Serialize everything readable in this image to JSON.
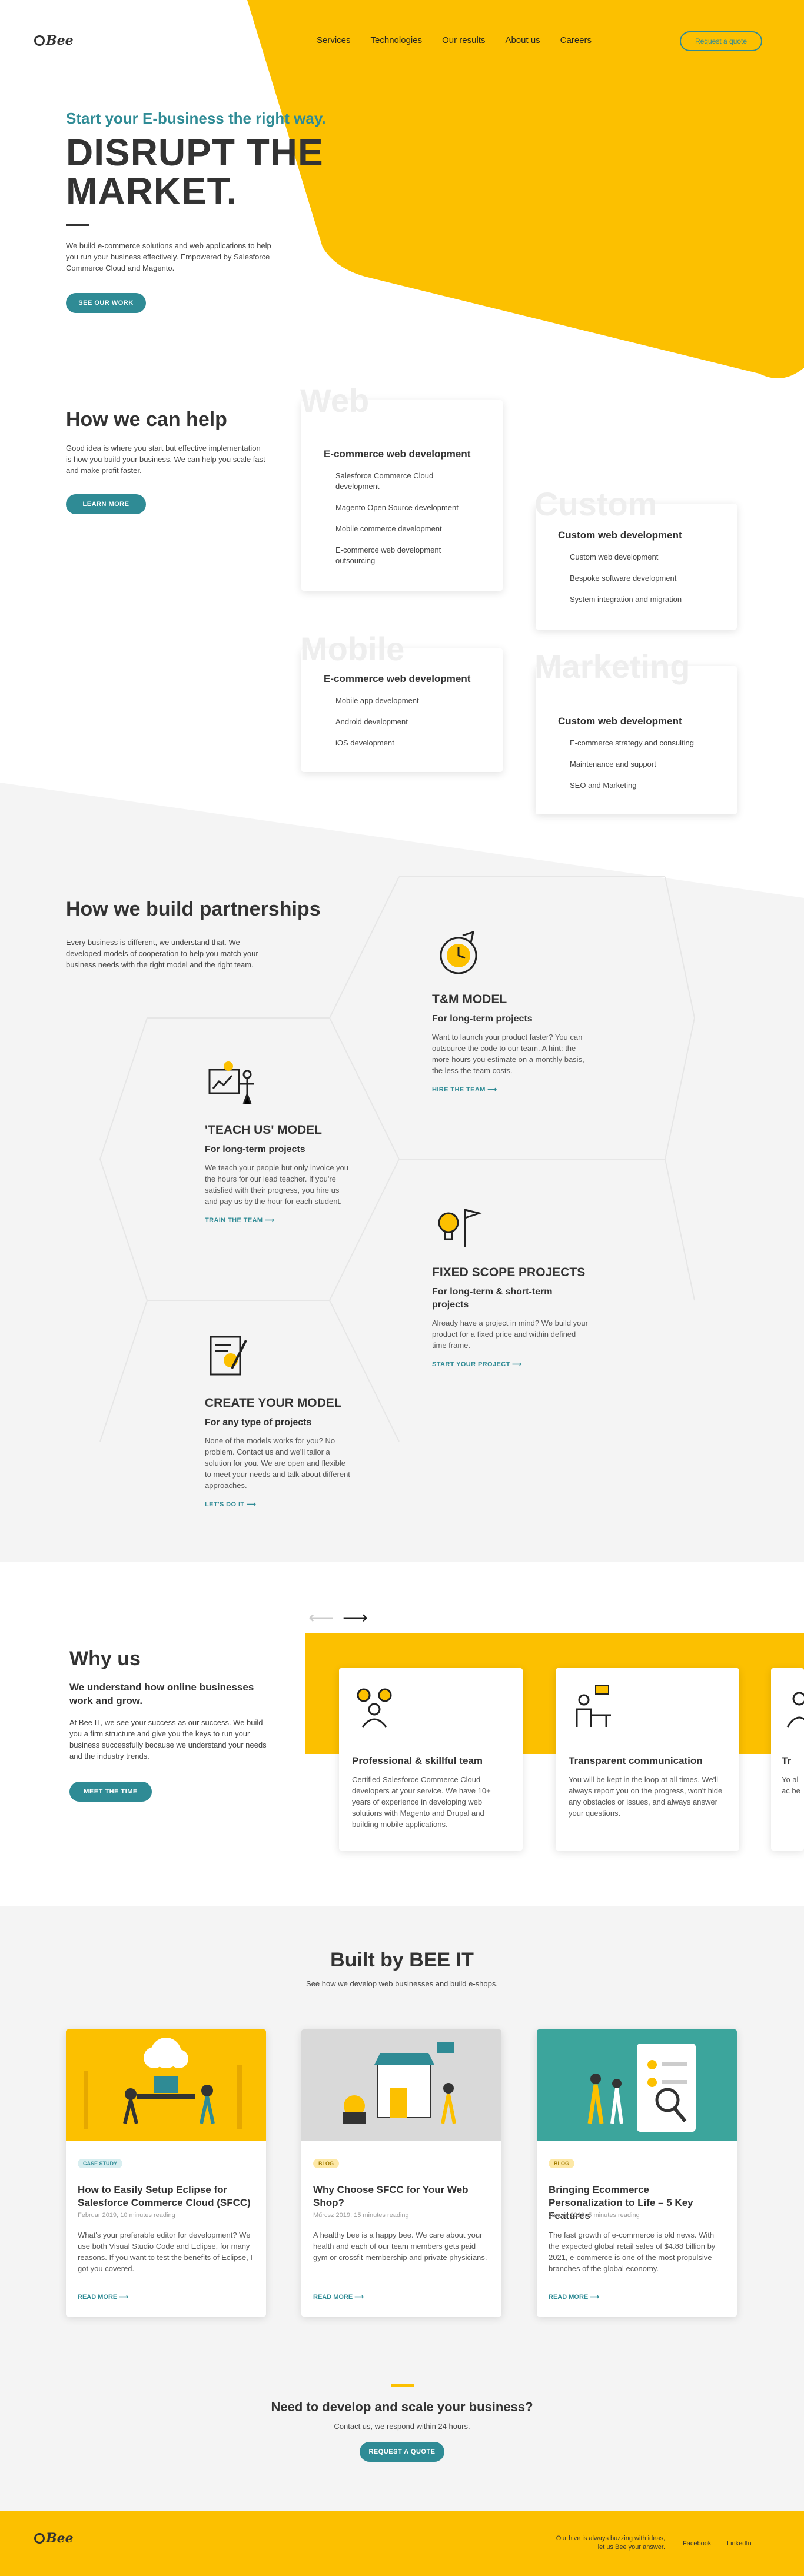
{
  "colors": {
    "accent": "#fcc000",
    "brand": "#2f8b95",
    "text": "#333333"
  },
  "nav": {
    "logo": "Bee",
    "links": [
      "Services",
      "Technologies",
      "Our results",
      "About us",
      "Careers"
    ],
    "cta": "Request a quote"
  },
  "hero": {
    "tag": "Start your E-business the right way.",
    "title_line1": "DISRUPT THE",
    "title_line2": "MARKET.",
    "text": "We build e-commerce solutions and web applications to help you run your business effectively. Empowered by Salesforce Commerce Cloud and Magento.",
    "button": "SEE OUR WORK"
  },
  "help": {
    "title": "How we can help",
    "text": "Good idea is where you start but effective implementation is how you build your business. We can help you scale fast and make profit faster.",
    "button": "LEARN MORE",
    "cards": [
      {
        "ghost": "Web",
        "title": "E-commerce web development",
        "items": [
          "Salesforce Commerce Cloud development",
          "Magento Open Source development",
          "Mobile commerce development",
          "E-commerce web development outsourcing"
        ]
      },
      {
        "ghost": "Custom",
        "title": "Custom web development",
        "items": [
          "Custom web development",
          "Bespoke software development",
          "System integration and migration"
        ]
      },
      {
        "ghost": "Mobile",
        "title": "E-commerce web development",
        "items": [
          "Mobile app development",
          "Android development",
          "iOS development"
        ]
      },
      {
        "ghost": "Marketing",
        "title": "Custom web development",
        "items": [
          "E-commerce strategy and consulting",
          "Maintenance and support",
          "SEO and Marketing"
        ]
      }
    ]
  },
  "partners": {
    "title": "How we build partnerships",
    "text": "Every business is different, we understand that. We developed models of cooperation to help you match your business needs with the right model and the right team.",
    "models": [
      {
        "icon": "clock-arrow-icon",
        "title": "T&M MODEL",
        "subtitle": "For long-term projects",
        "text": "Want to launch your product faster? You can outsource the code to our team. A hint: the more hours you estimate on a monthly basis, the less the team costs.",
        "link": "HIRE THE TEAM"
      },
      {
        "icon": "teacher-board-icon",
        "title": "'TEACH US' MODEL",
        "subtitle": "For long-term projects",
        "text": "We teach your people but only invoice you the hours for our lead teacher. If you're satisfied with their progress, you hire us and pay us by the hour for each student.",
        "link": "TRAIN THE TEAM"
      },
      {
        "icon": "lightbulb-flag-icon",
        "title": "FIXED SCOPE PROJECTS",
        "subtitle": "For long-term & short-term projects",
        "text": "Already have a project in mind? We build your product for a fixed price and within defined time frame.",
        "link": "START YOUR PROJECT"
      },
      {
        "icon": "document-pen-icon",
        "title": "CREATE YOUR MODEL",
        "subtitle": "For any type of projects",
        "text": "None of the models works for you? No problem. Contact us and we'll tailor a solution for you. We are open and flexible to meet your needs and talk about different approaches.",
        "link": "LET'S DO IT"
      }
    ]
  },
  "why": {
    "title": "Why us",
    "subtitle": "We understand how online businesses work and grow.",
    "text": "At Bee IT, we see your success as our success. We build you a firm structure and give you the keys to run your business successfully because we understand your needs and the industry trends.",
    "button": "MEET THE TIME",
    "cards": [
      {
        "icon": "team-gears-icon",
        "title": "Professional & skillful team",
        "text": "Certified Salesforce Commerce Cloud developers at your service. We have 10+ years of experience in developing web solutions with Magento and Drupal and building mobile applications."
      },
      {
        "icon": "desk-chat-icon",
        "title": "Transparent communication",
        "text": "You will be kept in the loop at all times. We'll always report you on the progress, won't hide any obstacles or issues, and always answer your questions."
      },
      {
        "icon": "person-icon",
        "title": "Tr",
        "text": "Yo al ac be"
      }
    ]
  },
  "built": {
    "title": "Built by BEE IT",
    "subtitle": "See how we develop web businesses and build e-shops.",
    "posts": [
      {
        "badge": "CASE STUDY",
        "title": "How to Easily Setup Eclipse for Salesforce Commerce Cloud (SFCC)",
        "meta": "Februar 2019, 10 minutes reading",
        "text": "What's your preferable editor for development? We use both Visual Studio Code and Eclipse, for many reasons. If you want to test the benefits of Eclipse, I got you covered.",
        "link": "READ MORE"
      },
      {
        "badge": "BLOG",
        "title": "Why Choose SFCC for Your Web Shop?",
        "meta": "Műrcsz 2019, 15 minutes reading",
        "text": "A healthy bee is a happy bee. We care about your health and each of our team members gets paid gym or crossfit membership and private physicians.",
        "link": "READ MORE"
      },
      {
        "badge": "BLOG",
        "title": "Bringing Ecommerce Personalization to Life – 5 Key Features",
        "meta": "Január 2019, 5 minutes reading",
        "text": "The fast growth of e-commerce is old news. With the expected global retail sales of $4.88 billion by 2021, e-commerce is one of the most propulsive branches of the global economy.",
        "link": "READ MORE"
      }
    ]
  },
  "cta": {
    "title": "Need to develop and scale your business?",
    "text": "Contact us, we respond within 24 hours.",
    "button": "REQUEST A QUOTE"
  },
  "footer": {
    "logo": "Bee",
    "tagline_1": "Our hive is always buzzing with ideas,",
    "tagline_2": "let us Bee your answer.",
    "links": [
      "Facebook",
      "LinkedIn"
    ]
  }
}
